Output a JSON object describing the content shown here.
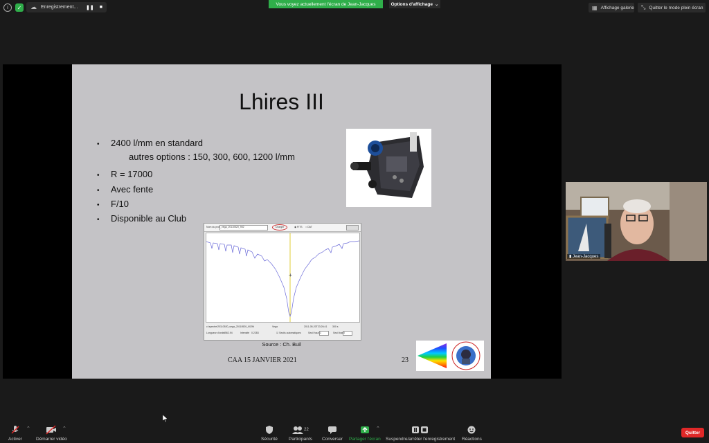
{
  "topbar": {
    "recording_label": "Enregistrement...",
    "share_banner": "Vous voyez actuellement l'écran de Jean-Jacques",
    "view_options": "Options d'affichage",
    "gallery_view": "Affichage galerie",
    "exit_fullscreen": "Quitter le mode plein écran"
  },
  "slide": {
    "title": "Lhires III",
    "bullets": [
      "2400 l/mm en standard",
      "R = 17000",
      "Avec fente",
      "F/10",
      "Disponible au Club"
    ],
    "sub_line": "autres options : 150, 300, 600, 1200 l/mm",
    "source": "Source : Ch. Buil",
    "footer": "CAA  15 JANVIER 2021",
    "page_number": "23",
    "spectrum_window": {
      "profile_label": "Nom du profil",
      "profile_value": "_vega_20110520_902",
      "charger_button": "Charger",
      "radio_fits": "FITS",
      "radio_dat": "DAT",
      "path_text": "c:\\spectre\\20110520_vega_20110520_902fit",
      "object_label": "Vega",
      "date_text": "2011-05-20T23:26:41",
      "exposure_text": "300 s",
      "wavelength_label": "Longueur d'onde",
      "wavelength_value": "6562.94",
      "intensity_label": "Intensité",
      "intensity_value": "0.2283",
      "auto_scale_label": "Seuils automatiques",
      "low_thresh_label": "Seuil haut",
      "low_thresh_value": "1",
      "high_thresh_label": "Seuil bas",
      "high_thresh_value": "0"
    }
  },
  "participant": {
    "name": "Jean-Jacques"
  },
  "toolbar": {
    "activate": "Activer",
    "start_video": "Démarrer vidéo",
    "security": "Sécurité",
    "participants": "Participants",
    "participants_count": "22",
    "chat": "Converser",
    "share_screen": "Partager l'écran",
    "record": "Suspendre/arrêter l'enregistrement",
    "reactions": "Réactions",
    "quit": "Quitter"
  },
  "colors": {
    "accent_green": "#2fae4a",
    "quit_red": "#e02828",
    "slide_bg": "#c4c3c6"
  }
}
